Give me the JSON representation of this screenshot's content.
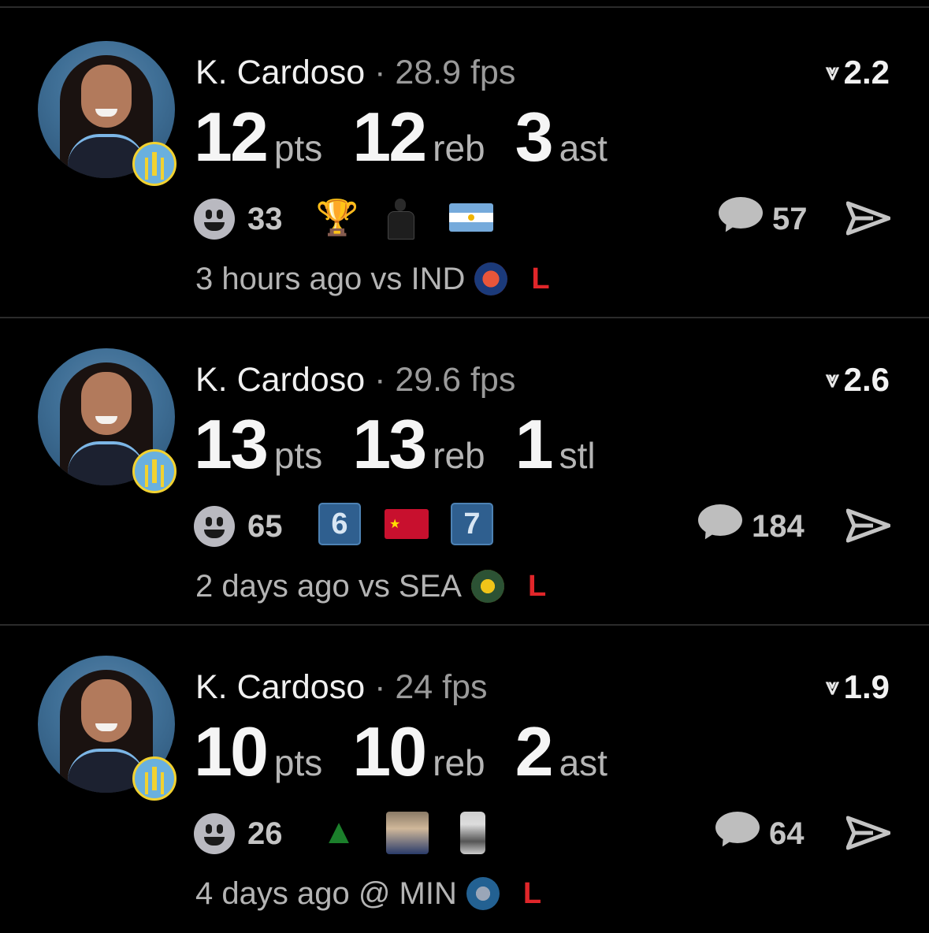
{
  "cards": [
    {
      "name": "K. Cardoso",
      "separator": "·",
      "fps": "28.9 fps",
      "rating": "2.2",
      "stats": [
        {
          "value": "12",
          "unit": "pts"
        },
        {
          "value": "12",
          "unit": "reb"
        },
        {
          "value": "3",
          "unit": "ast"
        }
      ],
      "reaction_count": "33",
      "reaction_emojis": [
        "trophy",
        "brooklyn-player",
        "argentina-flag"
      ],
      "comment_count": "57",
      "meta": "3 hours ago vs IND",
      "opponent_logo": "indiana-fever-logo",
      "result": "L"
    },
    {
      "name": "K. Cardoso",
      "separator": "·",
      "fps": "29.6 fps",
      "rating": "2.6",
      "stats": [
        {
          "value": "13",
          "unit": "pts"
        },
        {
          "value": "13",
          "unit": "reb"
        },
        {
          "value": "1",
          "unit": "stl"
        }
      ],
      "reaction_count": "65",
      "reaction_emojis": [
        "keycap-6",
        "china-flag",
        "keycap-7"
      ],
      "keycap_6": "6",
      "keycap_7": "7",
      "flag_star": "★",
      "comment_count": "184",
      "meta": "2 days ago vs SEA",
      "opponent_logo": "seattle-storm-logo",
      "result": "L"
    },
    {
      "name": "K. Cardoso",
      "separator": "·",
      "fps": "24 fps",
      "rating": "1.9",
      "stats": [
        {
          "value": "10",
          "unit": "pts"
        },
        {
          "value": "10",
          "unit": "reb"
        },
        {
          "value": "2",
          "unit": "ast"
        }
      ],
      "reaction_count": "26",
      "reaction_emojis": [
        "evergreen-tree",
        "player-photo",
        "person-photo"
      ],
      "comment_count": "64",
      "meta": "4 days ago @ MIN",
      "opponent_logo": "minnesota-lynx-logo",
      "result": "L"
    }
  ],
  "icons": {
    "rating": "triangle-down-icon",
    "reactions": "smiley-icon",
    "comments": "speech-bubble-icon",
    "share": "send-icon"
  },
  "glyphs": {
    "rating_triangle": "⩔",
    "trophy": "🏆",
    "tree": "▲"
  },
  "colors": {
    "background": "#000000",
    "result_loss": "#e0262a",
    "secondary_text": "#9a9a9a"
  }
}
